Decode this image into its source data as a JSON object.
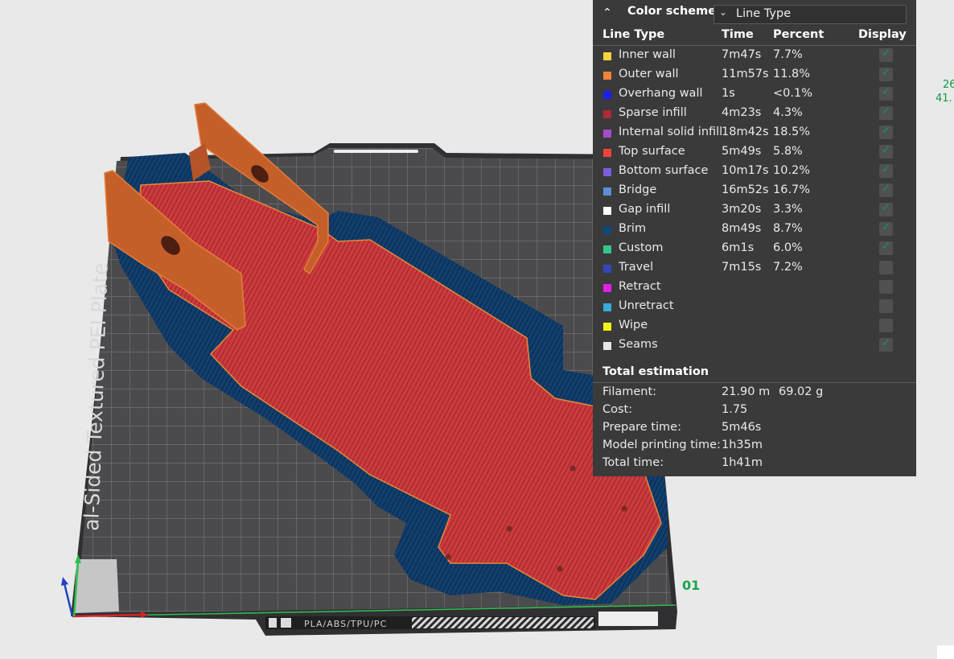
{
  "plate": {
    "side_label": "al-Sided Textured PEI Plate",
    "material_label": "PLA/ABS/TPU/PC",
    "plate_number": "01",
    "side_readout": [
      "26",
      "41."
    ]
  },
  "legend": {
    "title": "Color scheme",
    "scheme_value": "Line Type",
    "headers": {
      "type": "Line Type",
      "time": "Time",
      "percent": "Percent",
      "display": "Display"
    },
    "rows": [
      {
        "label": "Inner wall",
        "time": "7m47s",
        "percent": "7.7%",
        "color": "#f5d43a",
        "checked": true
      },
      {
        "label": "Outer wall",
        "time": "11m57s",
        "percent": "11.8%",
        "color": "#f0823a",
        "checked": true
      },
      {
        "label": "Overhang wall",
        "time": "1s",
        "percent": "<0.1%",
        "color": "#1e1ef2",
        "checked": true
      },
      {
        "label": "Sparse infill",
        "time": "4m23s",
        "percent": "4.3%",
        "color": "#b0283a",
        "checked": true
      },
      {
        "label": "Internal solid infill",
        "time": "18m42s",
        "percent": "18.5%",
        "color": "#a54cc9",
        "checked": true
      },
      {
        "label": "Top surface",
        "time": "5m49s",
        "percent": "5.8%",
        "color": "#f2453a",
        "checked": true
      },
      {
        "label": "Bottom surface",
        "time": "10m17s",
        "percent": "10.2%",
        "color": "#7a5fd6",
        "checked": true
      },
      {
        "label": "Bridge",
        "time": "16m52s",
        "percent": "16.7%",
        "color": "#5a8fd4",
        "checked": true
      },
      {
        "label": "Gap infill",
        "time": "3m20s",
        "percent": "3.3%",
        "color": "#ffffff",
        "checked": true
      },
      {
        "label": "Brim",
        "time": "8m49s",
        "percent": "8.7%",
        "color": "#0f4a7a",
        "checked": true
      },
      {
        "label": "Custom",
        "time": "6m1s",
        "percent": "6.0%",
        "color": "#35c48a",
        "checked": true
      },
      {
        "label": "Travel",
        "time": "7m15s",
        "percent": "7.2%",
        "color": "#3448b4",
        "checked": false
      },
      {
        "label": "Retract",
        "time": "",
        "percent": "",
        "color": "#e020e8",
        "checked": false
      },
      {
        "label": "Unretract",
        "time": "",
        "percent": "",
        "color": "#3aa9d8",
        "checked": false
      },
      {
        "label": "Wipe",
        "time": "",
        "percent": "",
        "color": "#f2f21c",
        "checked": false
      },
      {
        "label": "Seams",
        "time": "",
        "percent": "",
        "color": "#e6e6e6",
        "checked": true
      }
    ],
    "estimation": {
      "title": "Total estimation",
      "rows": [
        {
          "label": "Filament:",
          "v1": "21.90 m",
          "v2": "69.02 g"
        },
        {
          "label": "Cost:",
          "v1": "1.75",
          "v2": ""
        },
        {
          "label": "Prepare time:",
          "v1": "5m46s",
          "v2": ""
        },
        {
          "label": "Model printing time:",
          "v1": "1h35m",
          "v2": ""
        },
        {
          "label": "Total time:",
          "v1": "1h41m",
          "v2": ""
        }
      ]
    }
  }
}
